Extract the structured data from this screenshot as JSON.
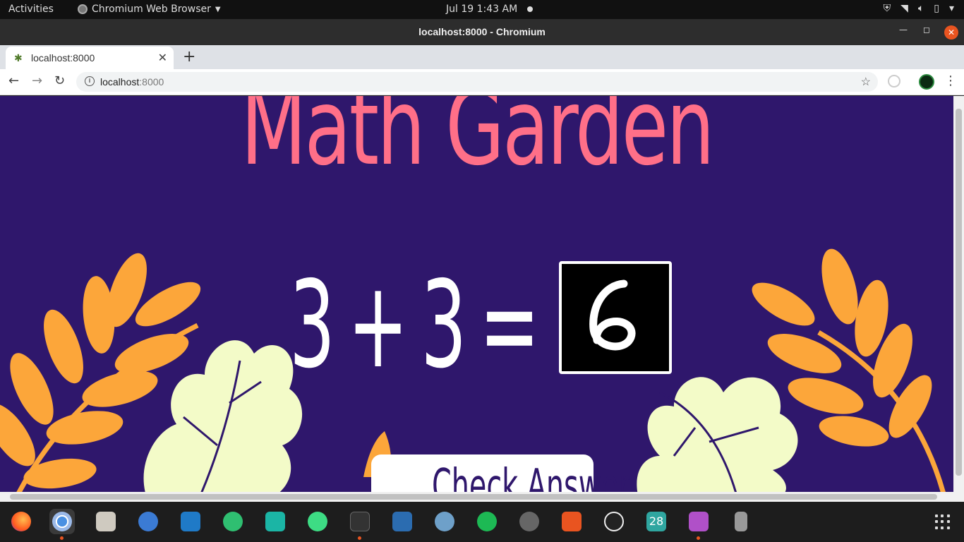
{
  "system_bar": {
    "activities": "Activities",
    "app_name": "Chromium Web Browser",
    "clock": "Jul 19  1:43 AM"
  },
  "window": {
    "title": "localhost:8000 - Chromium"
  },
  "tabs": [
    {
      "label": "localhost:8000",
      "active": true
    }
  ],
  "address_bar": {
    "host": "localhost",
    "port": ":8000"
  },
  "page": {
    "title": "Math Garden",
    "equation": {
      "a": "3",
      "op": "+",
      "b": "3",
      "equals": "="
    },
    "drawn_answer": "6",
    "check_button": "Check Answer"
  },
  "colors": {
    "page_background": "#2f176c",
    "title": "#ff6f88",
    "leaf_orange": "#fca63a",
    "leaf_cream": "#f3fbc8"
  },
  "dock": {
    "apps": [
      "firefox-icon",
      "chromium-icon",
      "files-icon",
      "thunderbird-icon",
      "vscode-icon",
      "atom-icon",
      "visual-studio-icon",
      "android-studio-icon",
      "terminal-icon",
      "writer-icon",
      "pgadmin-icon",
      "spotify-icon",
      "cheese-icon",
      "software-center-icon",
      "obs-icon",
      "calendar-icon",
      "video-icon",
      "usb-drive-icon"
    ],
    "calendar_day": "28"
  }
}
